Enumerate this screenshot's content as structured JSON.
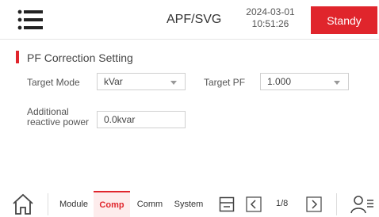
{
  "header": {
    "title": "APF/SVG",
    "date": "2024-03-01",
    "time": "10:51:26",
    "status": "Standy"
  },
  "section": {
    "title": "PF Correction Setting"
  },
  "form": {
    "target_mode_label": "Target Mode",
    "target_mode_value": "kVar",
    "target_pf_label": "Target PF",
    "target_pf_value": "1.000",
    "additional_label_line1": "Additional",
    "additional_label_line2": "reactive power",
    "additional_value": "0.0kvar"
  },
  "footer": {
    "tabs": [
      {
        "label": "Module"
      },
      {
        "label": "Comp"
      },
      {
        "label": "Comm"
      },
      {
        "label": "System"
      }
    ],
    "page": "1/8"
  },
  "colors": {
    "accent": "#e0252c"
  }
}
